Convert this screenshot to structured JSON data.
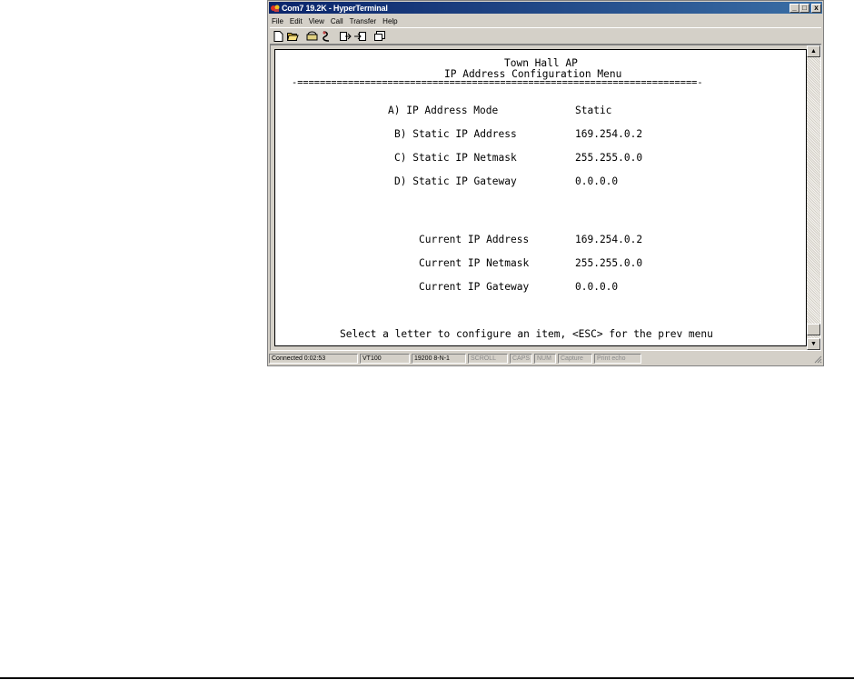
{
  "window": {
    "title": "Com7 19.2K - HyperTerminal",
    "buttons": {
      "minimize": "_",
      "maximize": "□",
      "close": "x"
    }
  },
  "menu": [
    "File",
    "Edit",
    "View",
    "Call",
    "Transfer",
    "Help"
  ],
  "toolbar": [
    "new-icon",
    "open-icon",
    "connect-icon",
    "disconnect-icon",
    "send-icon",
    "receive-icon",
    "properties-icon"
  ],
  "terminal": {
    "heading": "Town Hall AP",
    "subheading": "IP Address Configuration Menu",
    "rule": "-=======================================================================-",
    "options": [
      {
        "label": "A) IP Address Mode",
        "value": "Static"
      },
      {
        "label": "B) Static IP Address",
        "value": "169.254.0.2"
      },
      {
        "label": "C) Static IP Netmask",
        "value": "255.255.0.0"
      },
      {
        "label": "D) Static IP Gateway",
        "value": "0.0.0.0"
      }
    ],
    "current": [
      {
        "label": "Current IP Address",
        "value": "169.254.0.2"
      },
      {
        "label": "Current IP Netmask",
        "value": "255.255.0.0"
      },
      {
        "label": "Current IP Gateway",
        "value": "0.0.0.0"
      }
    ],
    "prompt": "Select a letter to configure an item, <ESC> for the prev menu"
  },
  "status": {
    "connected": "Connected 0:02:53",
    "emulation": "VT100",
    "settings": "19200 8-N-1",
    "scroll": "SCROLL",
    "caps": "CAPS",
    "num": "NUM",
    "capture": "Capture",
    "print_echo": "Print echo"
  },
  "colors": {
    "titlebar_start": "#0a246a",
    "titlebar_end": "#3a6ea5",
    "window_face": "#d4d0c8"
  }
}
